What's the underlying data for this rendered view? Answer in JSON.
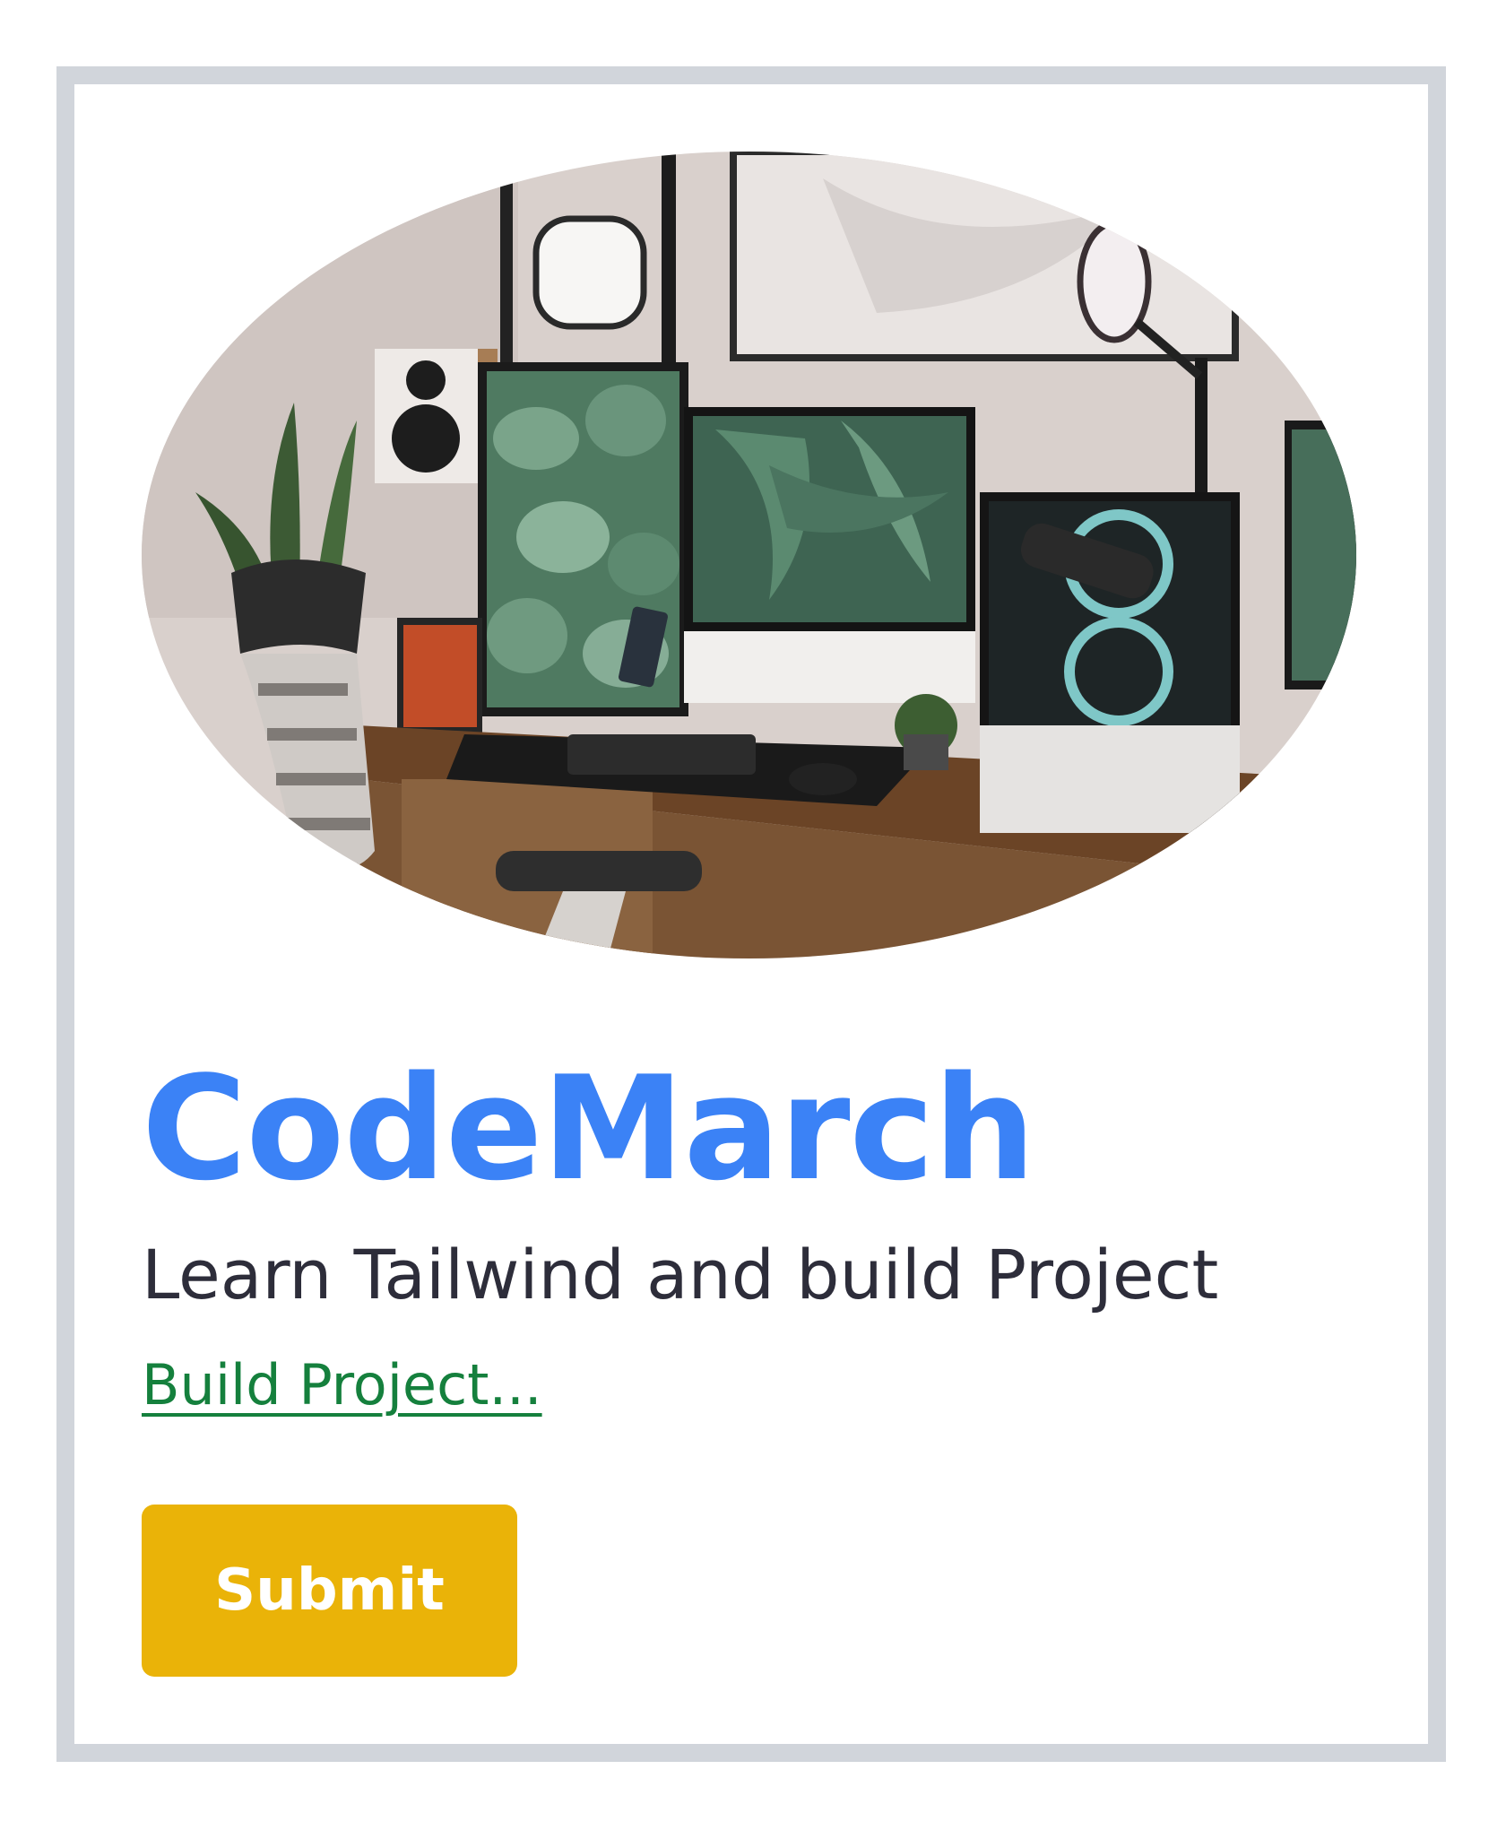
{
  "card": {
    "title": "CodeMarch",
    "subtitle": "Learn Tailwind and build Project",
    "link_label": "Build Project...",
    "button_label": "Submit",
    "image": "desk-setup-photo"
  },
  "colors": {
    "title": "#3b82f6",
    "link": "#15803d",
    "button": "#eab308",
    "border": "#d1d5db"
  }
}
